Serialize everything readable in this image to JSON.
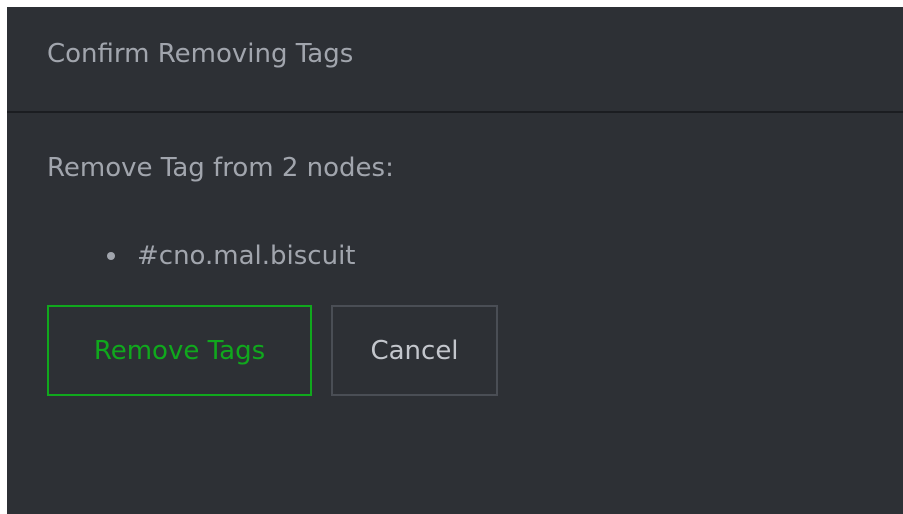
{
  "dialog": {
    "title": "Confirm Removing Tags",
    "message": "Remove Tag from 2 nodes:",
    "tags": [
      "#cno.mal.biscuit"
    ],
    "confirm_label": "Remove Tags",
    "cancel_label": "Cancel"
  },
  "colors": {
    "background": "#2d3035",
    "confirm_accent": "#10a81d",
    "text": "#a1a5ad"
  },
  "icons": {
    "bullet": "bullet-dot-icon"
  }
}
